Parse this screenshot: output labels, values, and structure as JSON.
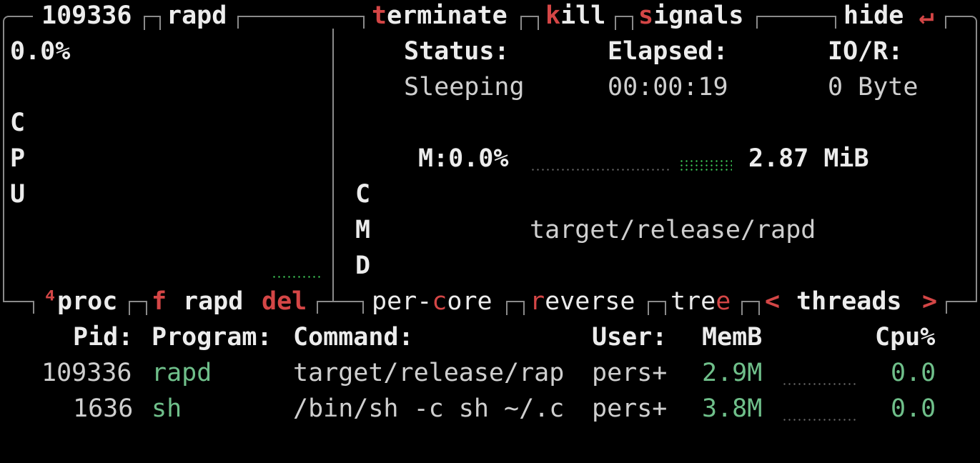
{
  "header": {
    "pid": "109336",
    "name": "rapd",
    "actions": [
      {
        "key": "t",
        "rest": "erminate"
      },
      {
        "key": "k",
        "rest": "ill"
      },
      {
        "key": "s",
        "rest": "ignals"
      }
    ],
    "hide_label": "hide",
    "hide_icon": "↵"
  },
  "cpu_panel": {
    "percent": "0.0%",
    "vertical_label": [
      "C",
      "P",
      "U"
    ]
  },
  "details": {
    "status_label": "Status:",
    "status_value": "Sleeping",
    "elapsed_label": "Elapsed:",
    "elapsed_value": "00:00:19",
    "io_label": "IO/R:",
    "io_value": "0 Byte",
    "mem_label": "M:0.0%",
    "mem_value": "2.87 MiB",
    "cmd_vertical": [
      "C",
      "M",
      "D"
    ],
    "cmd_value": "target/release/rapd"
  },
  "proc_bar": {
    "superscript": "⁴",
    "proc_label": "proc",
    "filter_key": "f",
    "filter_value": "rapd",
    "del_label": "del",
    "percore_a": "per-",
    "percore_key": "c",
    "percore_b": "ore",
    "reverse_key": "r",
    "reverse_rest": "everse",
    "tree_a": "tre",
    "tree_key": "e",
    "nav_left": "<",
    "threads_label": "threads",
    "nav_right": ">"
  },
  "table": {
    "headers": [
      "Pid:",
      "Program:",
      "Command:",
      "User:",
      "MemB",
      "Cpu%"
    ],
    "rows": [
      {
        "pid": "109336",
        "program": "rapd",
        "command": "target/release/rap",
        "user": "pers+",
        "mem": "2.9M",
        "cpu": "0.0"
      },
      {
        "pid": "1636",
        "program": "sh",
        "command": "/bin/sh -c sh ~/.c",
        "user": "pers+",
        "mem": "3.8M",
        "cpu": "0.0"
      }
    ]
  },
  "colors": {
    "accent": "#d44646",
    "value": "#6fbf8a",
    "meter": "#3fcf5a",
    "border": "#8a8a8a"
  }
}
